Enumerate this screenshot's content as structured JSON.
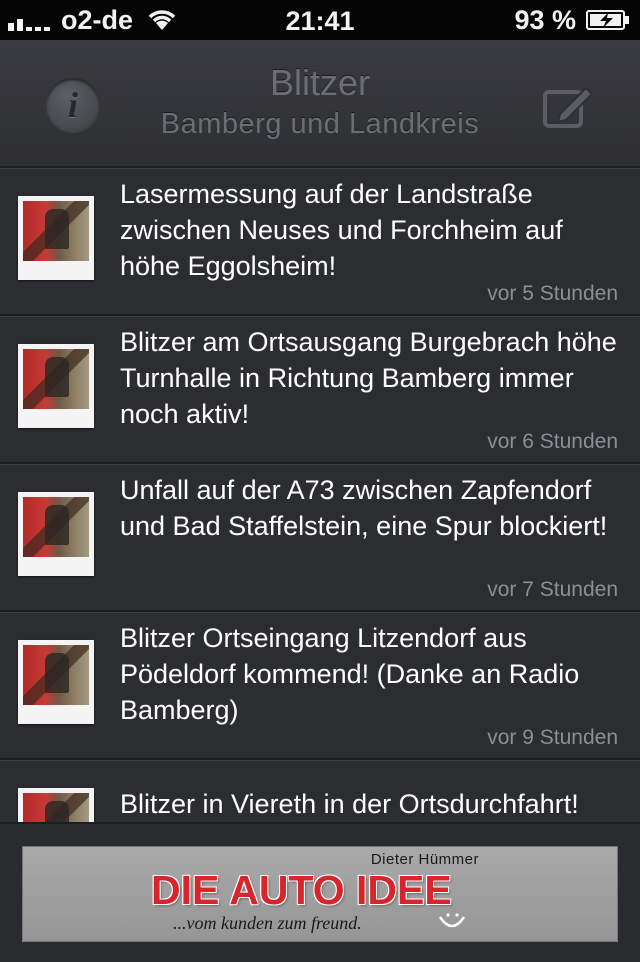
{
  "status_bar": {
    "carrier": "o2-de",
    "time": "21:41",
    "battery": "93 %"
  },
  "nav": {
    "title": "Blitzer",
    "subtitle": "Bamberg und Landkreis",
    "info_icon": "info-icon",
    "compose_icon": "compose-icon"
  },
  "items": [
    {
      "text": "Lasermessung auf der Landstraße zwischen Neuses und Forchheim auf höhe Eggolsheim!",
      "time": "vor 5 Stunden"
    },
    {
      "text": "Blitzer am Ortsausgang Burgebrach höhe Turnhalle in Richtung Bamberg immer noch aktiv!",
      "time": "vor 6 Stunden"
    },
    {
      "text": "Unfall auf der A73 zwischen Zapfendorf und Bad Staffelstein, eine Spur blockiert!",
      "time": "vor 7 Stunden"
    },
    {
      "text": "Blitzer Ortseingang Litzendorf aus Pödeldorf kommend! (Danke an Radio Bamberg)",
      "time": "vor 9 Stunden"
    },
    {
      "text": "Blitzer in Viereth in der Ortsdurchfahrt!",
      "time": ""
    }
  ],
  "ad": {
    "owner": "Dieter Hümmer",
    "brand": "DIE AUTO IDEE",
    "slogan": "...vom kunden zum freund."
  },
  "colors": {
    "background": "#2c2d31",
    "brand_red": "#d8242b",
    "timestamp": "#8d8e93"
  }
}
